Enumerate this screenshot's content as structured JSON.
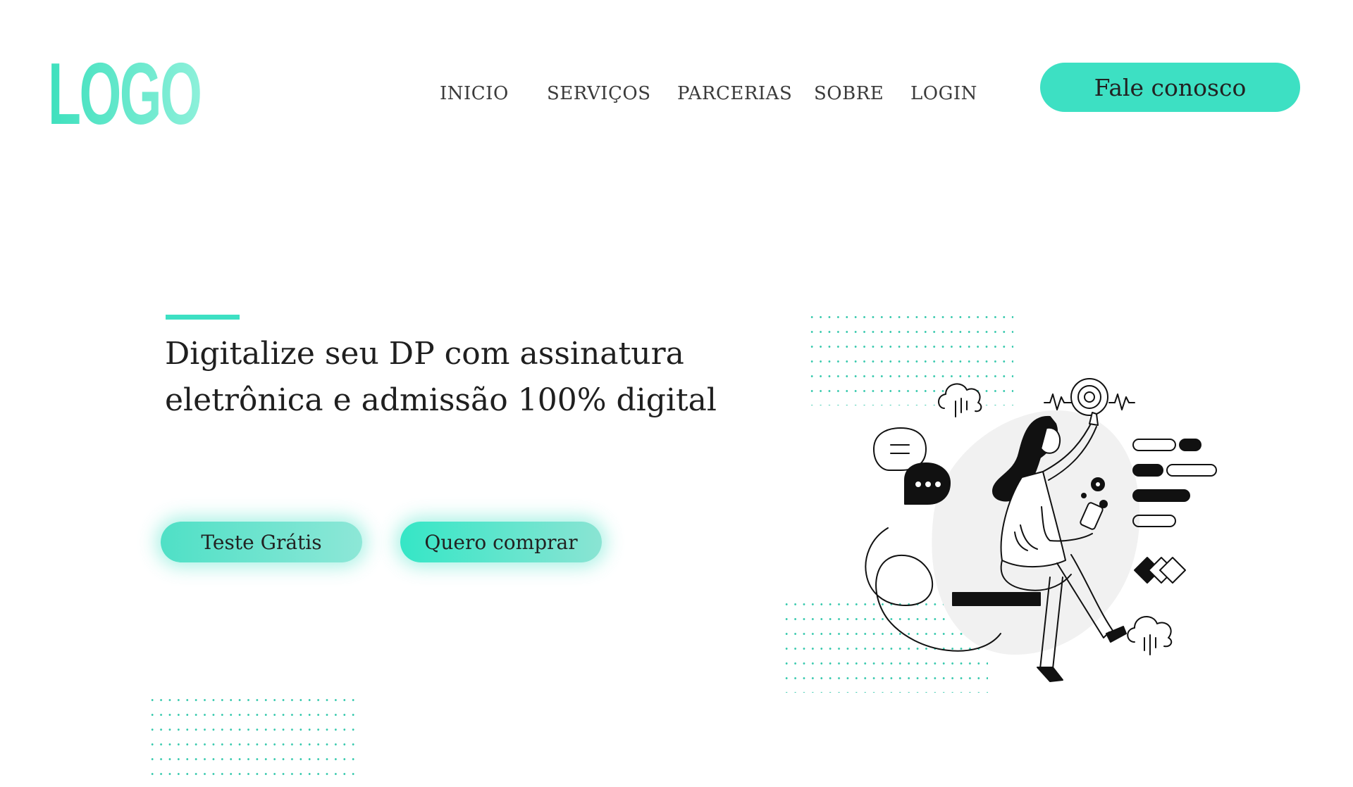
{
  "header": {
    "logo_text": "LOGO",
    "nav": [
      "INICIO",
      "SERVIÇOS",
      "PARCERIAS",
      "SOBRE",
      "LOGIN"
    ],
    "cta_label": "Fale conosco"
  },
  "hero": {
    "title_line_1": "Digitalize seu DP com assinatura",
    "title_line_2": "eletrônica e admissão 100% digital",
    "trial_button": "Teste Grátis",
    "buy_button": "Quero comprar"
  },
  "colors": {
    "accent": "#3de0c3",
    "text": "#1f1f1f",
    "illustration_bg": "#f1f1f1"
  },
  "icons": [
    "chat-bubble-icon",
    "typing-bubble-icon",
    "cloud-icon",
    "touch-icon",
    "diamond-icon"
  ]
}
